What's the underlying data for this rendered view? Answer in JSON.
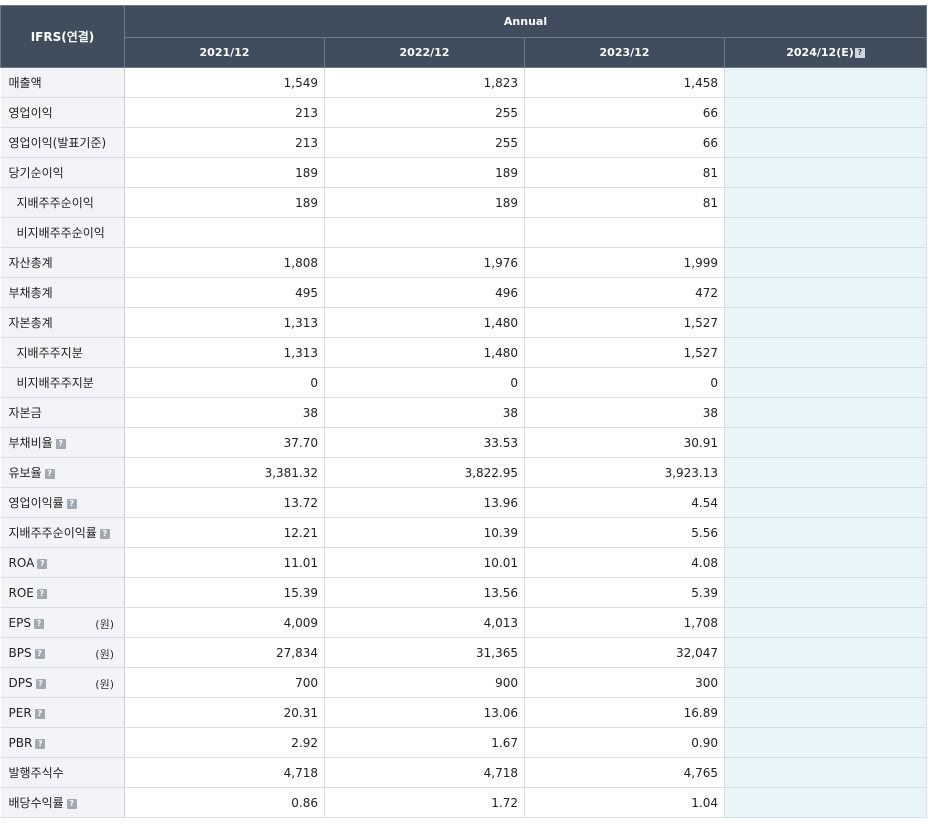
{
  "header": {
    "corner": "IFRS(연결)",
    "group": "Annual",
    "columns": [
      "2021/12",
      "2022/12",
      "2023/12",
      "2024/12(E)"
    ],
    "help_glyph": "?"
  },
  "rows": [
    {
      "label": "매출액",
      "sub": false,
      "help": false,
      "unit": "",
      "values": [
        "1,549",
        "1,823",
        "1,458",
        ""
      ]
    },
    {
      "label": "영업이익",
      "sub": false,
      "help": false,
      "unit": "",
      "values": [
        "213",
        "255",
        "66",
        ""
      ]
    },
    {
      "label": "영업이익(발표기준)",
      "sub": false,
      "help": false,
      "unit": "",
      "values": [
        "213",
        "255",
        "66",
        ""
      ]
    },
    {
      "label": "당기순이익",
      "sub": false,
      "help": false,
      "unit": "",
      "values": [
        "189",
        "189",
        "81",
        ""
      ]
    },
    {
      "label": "지배주주순이익",
      "sub": true,
      "help": false,
      "unit": "",
      "values": [
        "189",
        "189",
        "81",
        ""
      ]
    },
    {
      "label": "비지배주주순이익",
      "sub": true,
      "help": false,
      "unit": "",
      "values": [
        "",
        "",
        "",
        ""
      ]
    },
    {
      "label": "자산총계",
      "sub": false,
      "help": false,
      "unit": "",
      "values": [
        "1,808",
        "1,976",
        "1,999",
        ""
      ]
    },
    {
      "label": "부채총계",
      "sub": false,
      "help": false,
      "unit": "",
      "values": [
        "495",
        "496",
        "472",
        ""
      ]
    },
    {
      "label": "자본총계",
      "sub": false,
      "help": false,
      "unit": "",
      "values": [
        "1,313",
        "1,480",
        "1,527",
        ""
      ]
    },
    {
      "label": "지배주주지분",
      "sub": true,
      "help": false,
      "unit": "",
      "values": [
        "1,313",
        "1,480",
        "1,527",
        ""
      ]
    },
    {
      "label": "비지배주주지분",
      "sub": true,
      "help": false,
      "unit": "",
      "values": [
        "0",
        "0",
        "0",
        ""
      ]
    },
    {
      "label": "자본금",
      "sub": false,
      "help": false,
      "unit": "",
      "values": [
        "38",
        "38",
        "38",
        ""
      ]
    },
    {
      "label": "부채비율",
      "sub": false,
      "help": true,
      "unit": "",
      "values": [
        "37.70",
        "33.53",
        "30.91",
        ""
      ]
    },
    {
      "label": "유보율",
      "sub": false,
      "help": true,
      "unit": "",
      "values": [
        "3,381.32",
        "3,822.95",
        "3,923.13",
        ""
      ]
    },
    {
      "label": "영업이익률",
      "sub": false,
      "help": true,
      "unit": "",
      "values": [
        "13.72",
        "13.96",
        "4.54",
        ""
      ]
    },
    {
      "label": "지배주주순이익률",
      "sub": false,
      "help": true,
      "unit": "",
      "values": [
        "12.21",
        "10.39",
        "5.56",
        ""
      ]
    },
    {
      "label": "ROA",
      "sub": false,
      "help": true,
      "unit": "",
      "values": [
        "11.01",
        "10.01",
        "4.08",
        ""
      ]
    },
    {
      "label": "ROE",
      "sub": false,
      "help": true,
      "unit": "",
      "values": [
        "15.39",
        "13.56",
        "5.39",
        ""
      ]
    },
    {
      "label": "EPS",
      "sub": false,
      "help": true,
      "unit": "(원)",
      "values": [
        "4,009",
        "4,013",
        "1,708",
        ""
      ]
    },
    {
      "label": "BPS",
      "sub": false,
      "help": true,
      "unit": "(원)",
      "values": [
        "27,834",
        "31,365",
        "32,047",
        ""
      ]
    },
    {
      "label": "DPS",
      "sub": false,
      "help": true,
      "unit": "(원)",
      "values": [
        "700",
        "900",
        "300",
        ""
      ]
    },
    {
      "label": "PER",
      "sub": false,
      "help": true,
      "unit": "",
      "values": [
        "20.31",
        "13.06",
        "16.89",
        ""
      ]
    },
    {
      "label": "PBR",
      "sub": false,
      "help": true,
      "unit": "",
      "values": [
        "2.92",
        "1.67",
        "0.90",
        ""
      ]
    },
    {
      "label": "발행주식수",
      "sub": false,
      "help": false,
      "unit": "",
      "values": [
        "4,718",
        "4,718",
        "4,765",
        ""
      ]
    },
    {
      "label": "배당수익률",
      "sub": false,
      "help": true,
      "unit": "",
      "values": [
        "0.86",
        "1.72",
        "1.04",
        ""
      ]
    }
  ]
}
